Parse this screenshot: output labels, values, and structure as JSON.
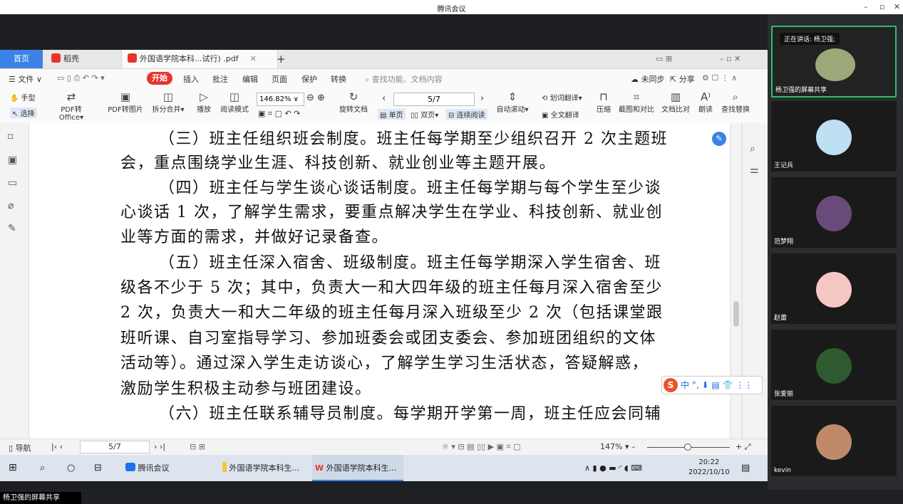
{
  "meeting": {
    "title": "腾讯会议",
    "window_controls": [
      "–",
      "▫",
      "✕"
    ],
    "share_label": "杨卫强的屏幕共享"
  },
  "wps": {
    "tabs": {
      "home": "首页",
      "docer": "稻壳",
      "pdf": "外国语学院本科...试行) .pdf",
      "add": "+"
    },
    "menu": {
      "file": "文件",
      "start": "开始",
      "items": [
        "插入",
        "批注",
        "编辑",
        "页面",
        "保护",
        "转换"
      ],
      "search": "查找功能、文档内容",
      "sync": "未同步",
      "share": "分享"
    },
    "ribbon": {
      "hand": "手型",
      "select": "选择",
      "pdf_to_office": "PDF转Office",
      "pdf_to_image": "PDF转图片",
      "split_merge": "拆分合并",
      "play": "播放",
      "read_mode": "阅读模式",
      "zoom": "146.82%",
      "rotate": "旋转文档",
      "page": "5/7",
      "single": "单页",
      "double": "双页",
      "continuous": "连续阅读",
      "auto_scroll": "自动滚动",
      "word_translate": "划词翻译",
      "full_translate": "全文翻译",
      "compress": "压缩",
      "screenshot": "截图和对比",
      "compare": "文档比对",
      "read_aloud": "朗读",
      "find_replace": "查找替换"
    },
    "document": {
      "lines": [
        "（三）班主任组织班会制度。班主任每学期至少组织召开 2 次主题班",
        "会，重点围绕学业生涯、科技创新、就业创业等主题开展。",
        "（四）班主任与学生谈心谈话制度。班主任每学期与每个学生至少谈",
        "心谈话 1 次，了解学生需求，要重点解决学生在学业、科技创新、就业创",
        "业等方面的需求，并做好记录备查。",
        "（五）班主任深入宿舍、班级制度。班主任每学期深入学生宿舍、班",
        "级各不少于 5 次；其中，负责大一和大四年级的班主任每月深入宿舍至少",
        "2 次，负责大一和大二年级的班主任每月深入班级至少 2 次（包括课堂跟",
        "班听课、自习室指导学习、参加班委会或团支委会、参加班团组织的文体",
        "活动等）。通过深入学生走访谈心，了解学生学习生活状态，答疑解惑，",
        "激励学生积极主动参与班团建设。",
        "（六）班主任联系辅导员制度。每学期开学第一周，班主任应会同辅"
      ]
    },
    "status": {
      "nav": "导航",
      "page": "5/7",
      "zoom": "147%"
    }
  },
  "taskbar": {
    "items": [
      "腾讯会议",
      "外国语学院本科生...",
      "外国语学院本科生..."
    ],
    "time": "20:22",
    "date": "2022/10/10"
  },
  "ime": {
    "label": "中 °, ⬇ ▤ 👕 ⋮⋮"
  },
  "participants": {
    "speaking": "正在讲话: 杨卫强;",
    "tiles": [
      {
        "name": "杨卫强的屏幕共享",
        "color": "#9aa87a"
      },
      {
        "name": "王记兵",
        "color": "#bfe0f2"
      },
      {
        "name": "范梦翔",
        "color": "#6a4a7a"
      },
      {
        "name": "赵蕾",
        "color": "#f4c7c3"
      },
      {
        "name": "张爱丽",
        "color": "#2f5a2f"
      },
      {
        "name": "kevin",
        "color": "#c08a6a"
      }
    ]
  }
}
